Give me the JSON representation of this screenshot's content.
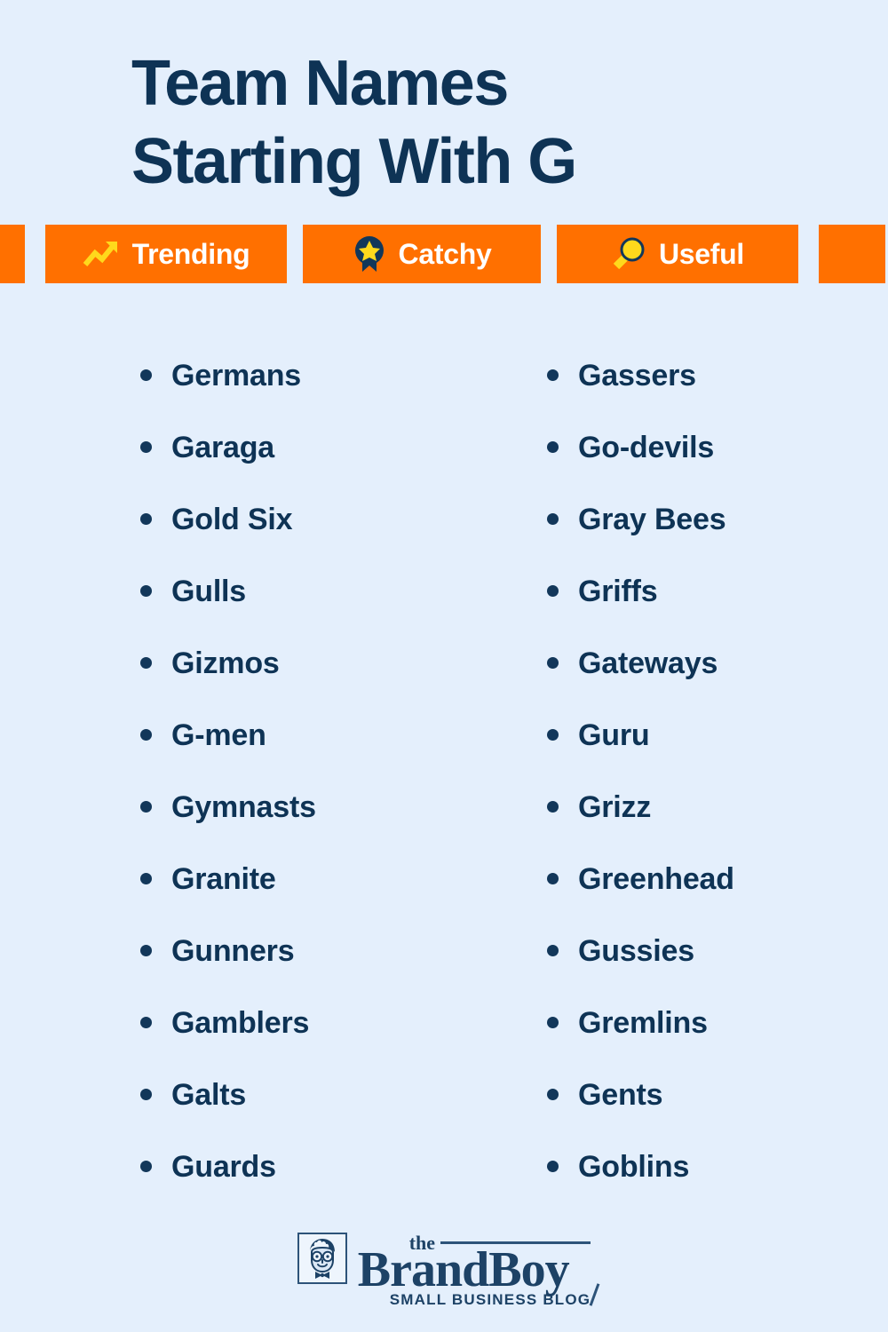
{
  "theme": {
    "background": "#e4effc",
    "navy": "#0e3355",
    "orange": "#ff7000",
    "yellow": "#ffd91c",
    "white": "#ffffff"
  },
  "header": {
    "title": "Team Names Starting With G",
    "title_lines": [
      "Team Names",
      "Starting With G"
    ]
  },
  "badge_bar": {
    "badges": [
      {
        "label": "Trending",
        "icon": "trending-up-icon"
      },
      {
        "label": "Catchy",
        "icon": "award-star-icon"
      },
      {
        "label": "Useful",
        "icon": "magnifying-glass-icon"
      }
    ]
  },
  "lists": {
    "left_column": [
      "Germans",
      "Garaga",
      "Gold Six",
      "Gulls",
      "Gizmos",
      "G-men",
      "Gymnasts",
      "Granite",
      "Gunners",
      "Gamblers",
      "Galts",
      "Guards"
    ],
    "right_column": [
      "Gassers",
      "Go-devils",
      "Gray Bees",
      "Griffs",
      "Gateways",
      "Guru",
      "Grizz",
      "Greenhead",
      "Gussies",
      "Gremlins",
      "Gents",
      "Goblins"
    ]
  },
  "footer": {
    "logo": {
      "the": "the",
      "brand": "BrandBoy",
      "tagline": "SMALL BUSINESS BLOG",
      "mark": "boy-face-icon"
    }
  }
}
